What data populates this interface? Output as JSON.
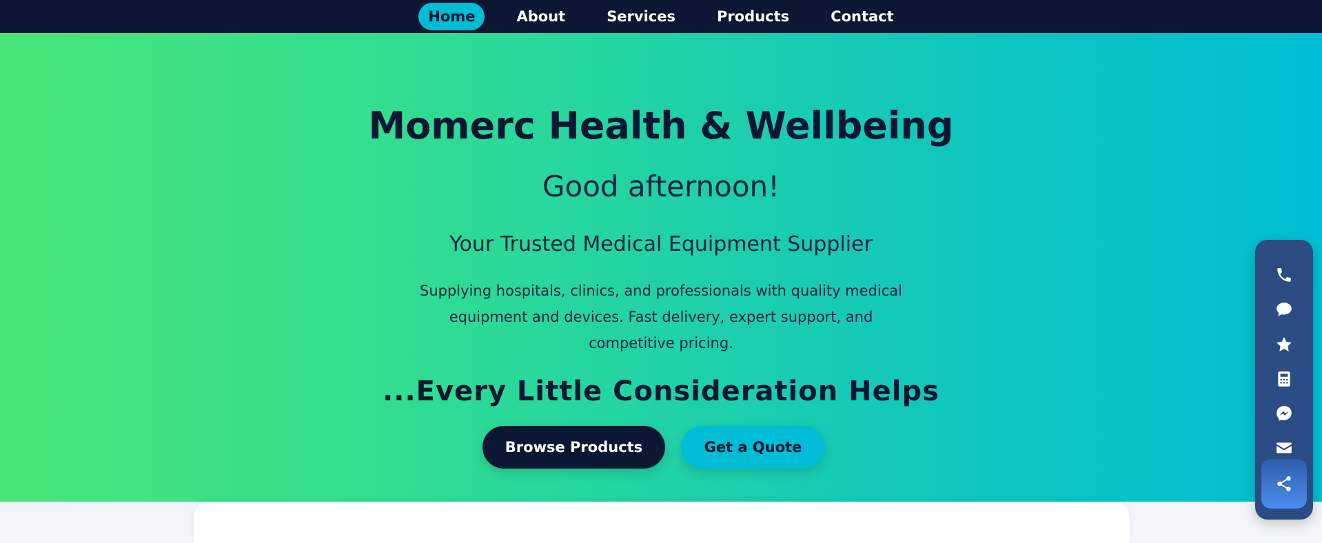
{
  "nav": {
    "items": [
      {
        "label": "Home",
        "active": true
      },
      {
        "label": "About",
        "active": false
      },
      {
        "label": "Services",
        "active": false
      },
      {
        "label": "Products",
        "active": false
      },
      {
        "label": "Contact",
        "active": false
      }
    ]
  },
  "hero": {
    "title": "Momerc Health & Wellbeing",
    "greeting": "Good afternoon!",
    "tagline": "Your Trusted Medical Equipment Supplier",
    "description": "Supplying hospitals, clinics, and professionals with quality medical equipment and devices. Fast delivery, expert support, and competitive pricing.",
    "motto": "...Every Little Consideration Helps",
    "browse_label": "Browse Products",
    "quote_label": "Get a Quote"
  },
  "dock": {
    "icons": [
      "phone-icon",
      "chat-icon",
      "star-icon",
      "calculator-icon",
      "messenger-icon",
      "email-icon",
      "share-icon"
    ]
  },
  "colors": {
    "nav_bg": "#0c1733",
    "accent": "#00bcd4",
    "gradient_start": "#48e678",
    "gradient_end": "#00bed4",
    "dock_bg": "#2c4c82"
  }
}
